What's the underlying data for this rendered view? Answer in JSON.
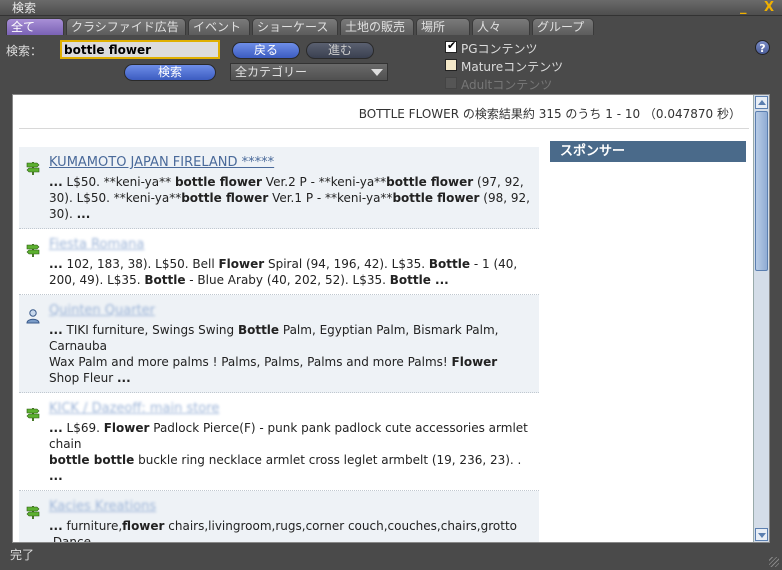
{
  "window": {
    "title": "検索",
    "minimize_glyph": "_",
    "close_glyph": "X"
  },
  "tabs": [
    {
      "label": "全て",
      "active": true
    },
    {
      "label": "クラシファイド広告",
      "active": false
    },
    {
      "label": "イベント",
      "active": false
    },
    {
      "label": "ショーケース",
      "active": false
    },
    {
      "label": "土地の販売",
      "active": false
    },
    {
      "label": "場所",
      "active": false
    },
    {
      "label": "人々",
      "active": false
    },
    {
      "label": "グループ",
      "active": false
    }
  ],
  "search": {
    "label": "検索：",
    "value": "bottle flower",
    "back_label": "戻る",
    "forward_label": "進む",
    "search_button_label": "検索",
    "category_selected": "全カテゴリー"
  },
  "filters": {
    "pg": {
      "label": "PGコンテンツ",
      "checked": true
    },
    "mature": {
      "label": "Matureコンテンツ",
      "checked": false
    },
    "adult": {
      "label": "Adultコンテンツ",
      "checked": false,
      "disabled": true
    }
  },
  "help_label": "?",
  "results_summary": "BOTTLE FLOWER の検索結果約 315 のうち 1 - 10 （0.047870 秒）",
  "sponsor_label": "スポンサー",
  "results": [
    {
      "icon": "signpost-icon",
      "title": "KUMAMOTO JAPAN FIRELAND *****",
      "blurred": false,
      "alt": true
    },
    {
      "icon": "signpost-icon",
      "title": "Fiesta Romana",
      "blurred": true,
      "alt": false
    },
    {
      "icon": "person-icon",
      "title": "Quinten Quarter",
      "blurred": true,
      "alt": true
    },
    {
      "icon": "signpost-icon",
      "title": "KICK / Dazeoff: main store",
      "blurred": true,
      "alt": false
    },
    {
      "icon": "signpost-icon",
      "title": "Kacies Kreations",
      "blurred": true,
      "alt": true
    }
  ],
  "status_text": "完了",
  "colors": {
    "accent_tab": "#8a72c4",
    "sponsor_bar": "#4a6a8a",
    "link": "#4a6a9a",
    "input_border": "#e0b000"
  }
}
